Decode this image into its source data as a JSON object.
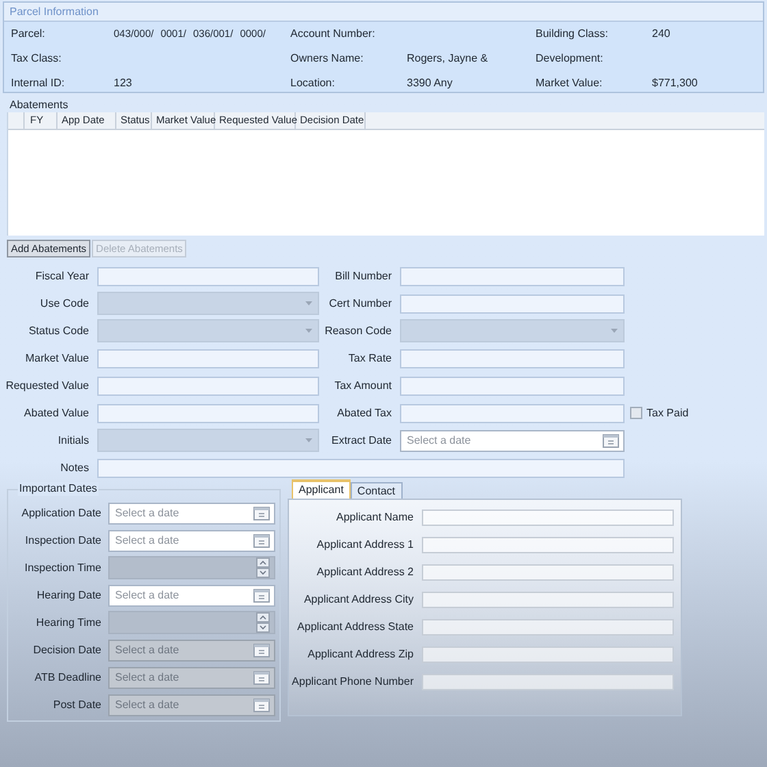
{
  "parcel_info": {
    "title": "Parcel Information",
    "fields": [
      {
        "label": "Parcel:",
        "values": [
          "043/000/",
          "0001/",
          "036/001/",
          "0000/"
        ]
      },
      {
        "label": "Account Number:"
      },
      {
        "label": "Building Class:",
        "values": [
          "240"
        ]
      },
      {
        "label": "Tax Class:"
      },
      {
        "label": "Owners Name:",
        "values": [
          "Rogers, Jayne &"
        ]
      },
      {
        "label": "Development:"
      },
      {
        "label": "Internal ID:",
        "values": [
          "123"
        ]
      },
      {
        "label": "Location:",
        "values": [
          "3390 Any"
        ]
      },
      {
        "label": "Market Value:",
        "values": [
          "$771,300"
        ]
      }
    ]
  },
  "abatements": {
    "title": "Abatements",
    "columns": [
      "FY",
      "App Date",
      "Status",
      "Market Value",
      "Requested Value",
      "Decision Date"
    ]
  },
  "buttons": [
    {
      "label": "Add Abatements",
      "disabled": false
    },
    {
      "label": "Delete Abatements",
      "disabled": true
    }
  ],
  "form_rows": [
    {
      "left": {
        "label": "Fiscal Year",
        "kind": "text",
        "disabled": false
      },
      "right": {
        "label": "Bill Number",
        "kind": "text",
        "disabled": false
      }
    },
    {
      "left": {
        "label": "Use Code",
        "kind": "select",
        "disabled": true
      },
      "right": {
        "label": "Cert Number",
        "kind": "text",
        "disabled": false
      }
    },
    {
      "left": {
        "label": "Status Code",
        "kind": "select",
        "disabled": true
      },
      "right": {
        "label": "Reason Code",
        "kind": "select",
        "disabled": true
      }
    },
    {
      "left": {
        "label": "Market Value",
        "kind": "text",
        "disabled": false
      },
      "right": {
        "label": "Tax Rate",
        "kind": "text",
        "disabled": false
      }
    },
    {
      "left": {
        "label": "Requested Value",
        "kind": "text",
        "disabled": false
      },
      "right": {
        "label": "Tax Amount",
        "kind": "text",
        "disabled": false
      }
    },
    {
      "left": {
        "label": "Abated Value",
        "kind": "text",
        "disabled": false
      },
      "right": {
        "label": "Abated Tax",
        "kind": "text",
        "disabled": false
      },
      "checkbox": {
        "label": "Tax Paid",
        "checked": false
      }
    },
    {
      "left": {
        "label": "Initials",
        "kind": "select",
        "disabled": true
      },
      "right": {
        "label": "Extract Date",
        "kind": "date",
        "disabled": false,
        "placeholder": "Select a date"
      }
    },
    {
      "left": {
        "label": "Notes",
        "kind": "wide",
        "disabled": false
      }
    }
  ],
  "important_dates": {
    "title": "Important Dates",
    "fields": [
      {
        "label": "Application Date",
        "kind": "date",
        "disabled": false,
        "placeholder": "Select a date"
      },
      {
        "label": "Inspection Date",
        "kind": "date",
        "disabled": false,
        "placeholder": "Select a date"
      },
      {
        "label": "Inspection Time",
        "kind": "time",
        "disabled": true
      },
      {
        "label": "Hearing Date",
        "kind": "date",
        "disabled": false,
        "placeholder": "Select a date"
      },
      {
        "label": "Hearing Time",
        "kind": "time",
        "disabled": true
      },
      {
        "label": "Decision Date",
        "kind": "date",
        "disabled": true,
        "placeholder": "Select a date"
      },
      {
        "label": "ATB Deadline",
        "kind": "date",
        "disabled": true,
        "placeholder": "Select a date"
      },
      {
        "label": "Post Date",
        "kind": "date",
        "disabled": true,
        "placeholder": "Select a date"
      }
    ]
  },
  "tabs": [
    {
      "label": "Applicant",
      "selected": true
    },
    {
      "label": "Contact",
      "selected": false
    }
  ],
  "applicant_fields": [
    {
      "label": "Applicant Name"
    },
    {
      "label": "Applicant Address 1"
    },
    {
      "label": "Applicant Address 2"
    },
    {
      "label": "Applicant Address City"
    },
    {
      "label": "Applicant Address State"
    },
    {
      "label": "Applicant Address Zip"
    },
    {
      "label": "Applicant Phone Number"
    }
  ]
}
